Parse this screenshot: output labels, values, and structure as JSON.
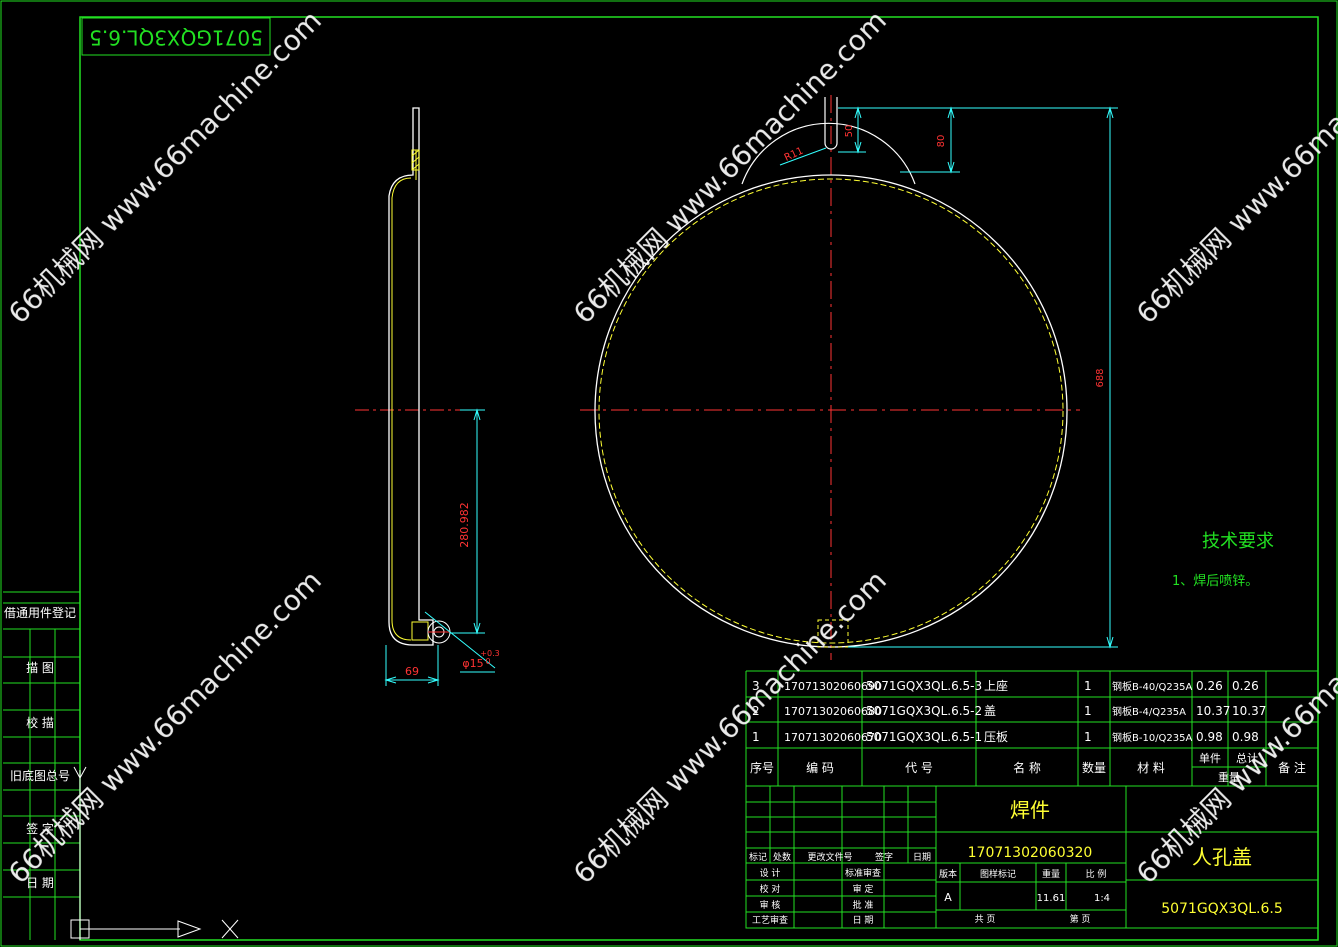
{
  "drawing_code_box": "5071GQX3QL.6.5",
  "side_panel": {
    "items": [
      "借通用件登记",
      "描 图",
      "校 描",
      "旧底图总号",
      "签 字",
      "日 期"
    ]
  },
  "dimensions": {
    "side_width": "69",
    "side_height": "280.982",
    "hole": "φ15",
    "hole_tol": "+0.3",
    "hole_tol_lower": "0",
    "slot_radius": "R11",
    "slot_depth": "50",
    "slot_top": "80",
    "diameter_total": "688"
  },
  "tech": {
    "title": "技术要求",
    "items": [
      "1、焊后喷锌。"
    ]
  },
  "bom": {
    "rows": [
      {
        "no": "3",
        "code": "17071302060690",
        "drawing": "5071GQX3QL.6.5-3",
        "name": "上座",
        "qty": "1",
        "material": "钢板B-40/Q235A",
        "unit_w": "0.26",
        "total_w": "0.26",
        "note": ""
      },
      {
        "no": "2",
        "code": "17071302060680",
        "drawing": "5071GQX3QL.6.5-2",
        "name": "盖",
        "qty": "1",
        "material": "钢板B-4/Q235A",
        "unit_w": "10.37",
        "total_w": "10.37",
        "note": ""
      },
      {
        "no": "1",
        "code": "17071302060670",
        "drawing": "5071GQX3QL.6.5-1",
        "name": "压板",
        "qty": "1",
        "material": "钢板B-10/Q235A",
        "unit_w": "0.98",
        "total_w": "0.98",
        "note": ""
      }
    ],
    "header": {
      "no": "序号",
      "code": "编 码",
      "drawing": "代 号",
      "name": "名 称",
      "qty": "数量",
      "material": "材 料",
      "unit_w": "单件",
      "total_w": "总计",
      "weight": "重量",
      "note": "备 注"
    }
  },
  "title_block": {
    "weld": "焊件",
    "part_code": "17071302060320",
    "part_name": "人孔盖",
    "drawing_no": "5071GQX3QL.6.5",
    "rev_labels": [
      "标记",
      "处数",
      "更改文件号",
      "签字",
      "日期"
    ],
    "left_labels": [
      "设 计",
      "校 对",
      "审 核",
      "工艺审查"
    ],
    "mid_labels": [
      "标准审查",
      "审 定",
      "批 准",
      "日 期"
    ],
    "stage_label": "版本",
    "mark_label": "图样标记",
    "weight_label": "重量",
    "scale_label": "比 例",
    "stage": "A",
    "weight": "11.61",
    "scale": "1:4",
    "sheets_total": "共 页",
    "sheet_no": "第 页"
  },
  "watermark": "66机械网 www.66machine.com",
  "colors": {
    "frame": "#22e022",
    "part": "#ffff33",
    "outline": "#ffffff",
    "center": "#ff3333",
    "dim": "#33ffff"
  }
}
